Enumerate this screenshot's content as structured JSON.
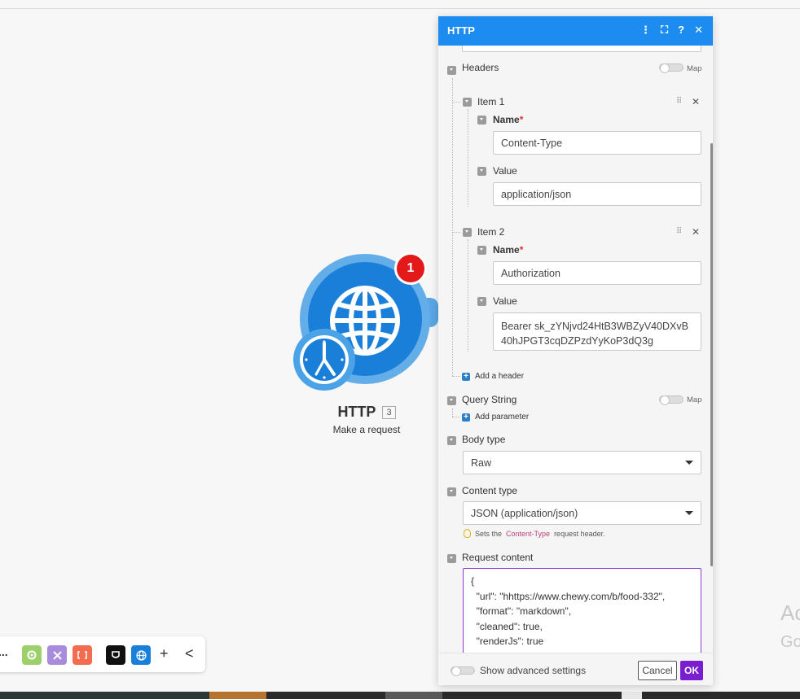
{
  "canvas": {
    "module": {
      "title": "HTTP",
      "number": "3",
      "subtitle": "Make a request",
      "badge": "1"
    },
    "side_text_1": "Ac",
    "side_text_2": "Go"
  },
  "toolbar": {
    "more": "...",
    "plus": "+",
    "collapse": "<"
  },
  "panel": {
    "title": "HTTP",
    "icons": {
      "more": "⋮",
      "expand": "⛶",
      "help": "?",
      "close": "✕"
    },
    "headers": {
      "label": "Headers",
      "map_label": "Map",
      "items": [
        {
          "label": "Item 1",
          "name_label": "Name",
          "name_value": "Content-Type",
          "value_label": "Value",
          "value_value": "application/json"
        },
        {
          "label": "Item 2",
          "name_label": "Name",
          "name_value": "Authorization",
          "value_label": "Value",
          "value_value_line1": "Bearer sk_zYNjvd24HtB3WBZyV40DXvB",
          "value_value_line2": "40hJPGT3cqDZPzdYyKoP3dQ3g"
        }
      ],
      "required_mark": "*",
      "add_label": "Add a header"
    },
    "query_string": {
      "label": "Query String",
      "map_label": "Map",
      "add_label": "Add parameter"
    },
    "body_type": {
      "label": "Body type",
      "value": "Raw"
    },
    "content_type": {
      "label": "Content type",
      "value": "JSON (application/json)",
      "hint_prefix": "Sets the",
      "hint_code": "Content-Type",
      "hint_suffix": "request header."
    },
    "request_content": {
      "label": "Request content",
      "value": "{\n  \"url\": \"hhttps://www.chewy.com/b/food-332\",\n  \"format\": \"markdown\",\n  \"cleaned\": true,\n  \"renderJs\": true\n}"
    },
    "footer": {
      "advanced_label": "Show advanced settings",
      "cancel_label": "Cancel",
      "ok_label": "OK"
    }
  },
  "colors": {
    "header_blue": "#1c8cf1",
    "ok_purple": "#7a1fd0",
    "module_blue": "#1a7fd9",
    "badge_red": "#e41a1a"
  }
}
